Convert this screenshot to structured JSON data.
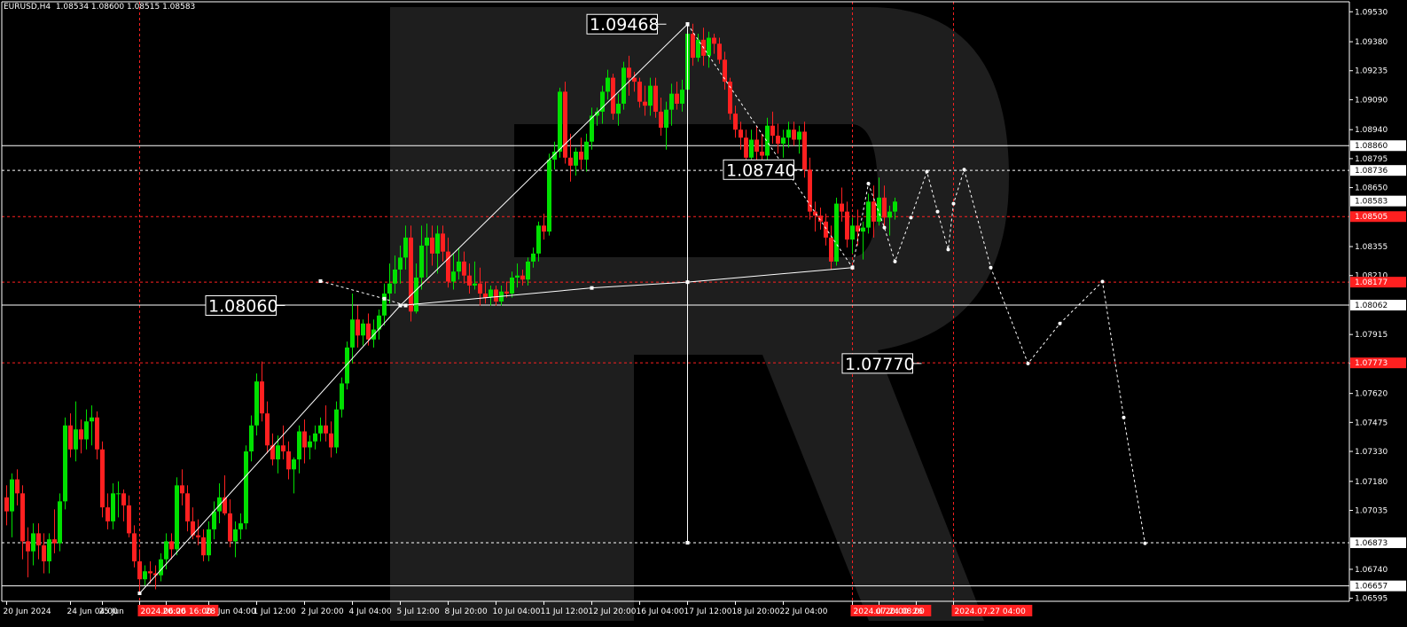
{
  "symbol_info": "EURUSD,H4  1.08534 1.08600 1.08515 1.08583",
  "colors": {
    "background": "#000000",
    "bull": "#00e000",
    "bear": "#ff2020",
    "grid": "#ff2020",
    "axis": "#ffffff",
    "watermark": "#222222"
  },
  "watermark_icon": "robo-r-logo",
  "chart_data": {
    "type": "candlestick",
    "title": "",
    "ylim": [
      1.0658,
      1.0958
    ],
    "price_ticks": [
      "1.09530",
      "1.09380",
      "1.09235",
      "1.09090",
      "1.08940",
      "1.08795",
      "1.08650",
      "1.08355",
      "1.08210",
      "1.07915",
      "1.07770",
      "1.07620",
      "1.07475",
      "1.07330",
      "1.07180",
      "1.07035",
      "1.06740",
      "1.06595"
    ],
    "highlighted_levels": [
      {
        "label": "1.08860",
        "style": "solid-white"
      },
      {
        "label": "1.08736",
        "style": "dashed-white"
      },
      {
        "label": "1.08583",
        "style": "current-price"
      },
      {
        "label": "1.08505",
        "style": "red-level"
      },
      {
        "label": "1.08177",
        "style": "red-level"
      },
      {
        "label": "1.08062",
        "style": "solid-white"
      },
      {
        "label": "1.07773",
        "style": "red-level"
      },
      {
        "label": "1.06873",
        "style": "dashed-white"
      },
      {
        "label": "1.06657",
        "style": "solid-white"
      }
    ],
    "time_ticks": [
      {
        "label": "20 Jun 2024",
        "i": 0
      },
      {
        "label": "24 Jun 04:00",
        "i": 12
      },
      {
        "label": "25 Jun",
        "i": 18
      },
      {
        "label": "2024.06.26 16:00",
        "i": 25,
        "highlight": true
      },
      {
        "label": "20:00",
        "i": 30
      },
      {
        "label": "28 Jun 04:00",
        "i": 38
      },
      {
        "label": "1 Jul 12:00",
        "i": 47
      },
      {
        "label": "2 Jul 20:00",
        "i": 56
      },
      {
        "label": "4 Jul 04:00",
        "i": 65
      },
      {
        "label": "5 Jul 12:00",
        "i": 74
      },
      {
        "label": "8 Jul 20:00",
        "i": 83
      },
      {
        "label": "10 Jul 04:00",
        "i": 92
      },
      {
        "label": "11 Jul 12:00",
        "i": 101
      },
      {
        "label": "12 Jul 20:00",
        "i": 110
      },
      {
        "label": "16 Jul 04:00",
        "i": 119
      },
      {
        "label": "17 Jul 12:00",
        "i": 128
      },
      {
        "label": "18 Jul 20:00",
        "i": 137
      },
      {
        "label": "22 Jul 04:00",
        "i": 146
      },
      {
        "label": "2024.07.24 08:00",
        "i": 159,
        "highlight": true
      },
      {
        "label": "ul 20:00",
        "i": 164
      },
      {
        "label": "26",
        "i": 171
      },
      {
        "label": "2024.07.27 04:00",
        "i": 178,
        "highlight": true
      }
    ],
    "candles": [
      [
        1.071,
        1.0716,
        1.0696,
        1.0703
      ],
      [
        1.0703,
        1.0722,
        1.069,
        1.0719
      ],
      [
        1.0719,
        1.0724,
        1.0706,
        1.0712
      ],
      [
        1.0712,
        1.0716,
        1.0679,
        1.0688
      ],
      [
        1.0688,
        1.0695,
        1.067,
        1.0683
      ],
      [
        1.0683,
        1.0697,
        1.0676,
        1.0692
      ],
      [
        1.0692,
        1.0697,
        1.0679,
        1.0686
      ],
      [
        1.0686,
        1.0692,
        1.0672,
        1.0678
      ],
      [
        1.0678,
        1.0692,
        1.0672,
        1.0689
      ],
      [
        1.0689,
        1.0704,
        1.0682,
        1.0687
      ],
      [
        1.0687,
        1.0712,
        1.0683,
        1.0708
      ],
      [
        1.0708,
        1.075,
        1.0704,
        1.0746
      ],
      [
        1.0746,
        1.0752,
        1.073,
        1.0734
      ],
      [
        1.0734,
        1.0758,
        1.0728,
        1.0744
      ],
      [
        1.0744,
        1.0749,
        1.0732,
        1.0739
      ],
      [
        1.0739,
        1.0754,
        1.0734,
        1.0748
      ],
      [
        1.0748,
        1.0756,
        1.0736,
        1.075
      ],
      [
        1.075,
        1.0753,
        1.0729,
        1.0734
      ],
      [
        1.0734,
        1.0738,
        1.07,
        1.0705
      ],
      [
        1.0705,
        1.0712,
        1.0694,
        1.0698
      ],
      [
        1.0698,
        1.0717,
        1.0694,
        1.0712
      ],
      [
        1.0712,
        1.0718,
        1.07,
        1.0712
      ],
      [
        1.0712,
        1.0714,
        1.0698,
        1.0706
      ],
      [
        1.0706,
        1.0711,
        1.069,
        1.0692
      ],
      [
        1.0692,
        1.0696,
        1.0675,
        1.0678
      ],
      [
        1.0678,
        1.0684,
        1.0662,
        1.0669
      ],
      [
        1.0669,
        1.0676,
        1.0666,
        1.0673
      ],
      [
        1.0673,
        1.0678,
        1.0667,
        1.0672
      ],
      [
        1.0672,
        1.0676,
        1.0664,
        1.0671
      ],
      [
        1.0671,
        1.0682,
        1.0668,
        1.0679
      ],
      [
        1.0679,
        1.0692,
        1.0674,
        1.0688
      ],
      [
        1.0688,
        1.0692,
        1.0679,
        1.0684
      ],
      [
        1.0684,
        1.072,
        1.0681,
        1.0716
      ],
      [
        1.0716,
        1.0724,
        1.0706,
        1.0712
      ],
      [
        1.0712,
        1.0716,
        1.0693,
        1.0698
      ],
      [
        1.0698,
        1.0705,
        1.0689,
        1.0691
      ],
      [
        1.0691,
        1.0699,
        1.0686,
        1.069
      ],
      [
        1.069,
        1.0694,
        1.0678,
        1.0681
      ],
      [
        1.0681,
        1.0698,
        1.0678,
        1.0694
      ],
      [
        1.0694,
        1.0708,
        1.0689,
        1.0703
      ],
      [
        1.0703,
        1.0717,
        1.0697,
        1.071
      ],
      [
        1.071,
        1.0721,
        1.0701,
        1.0702
      ],
      [
        1.0702,
        1.0709,
        1.0685,
        1.0688
      ],
      [
        1.0688,
        1.0698,
        1.068,
        1.0694
      ],
      [
        1.0694,
        1.0702,
        1.0689,
        1.0697
      ],
      [
        1.0697,
        1.0736,
        1.0694,
        1.0733
      ],
      [
        1.0733,
        1.0751,
        1.0728,
        1.0746
      ],
      [
        1.0746,
        1.0772,
        1.0741,
        1.0768
      ],
      [
        1.0768,
        1.0778,
        1.0748,
        1.0752
      ],
      [
        1.0752,
        1.0758,
        1.0732,
        1.0736
      ],
      [
        1.0736,
        1.0742,
        1.0726,
        1.0729
      ],
      [
        1.0729,
        1.0741,
        1.0722,
        1.0736
      ],
      [
        1.0736,
        1.0746,
        1.0729,
        1.0733
      ],
      [
        1.0733,
        1.0738,
        1.0719,
        1.0724
      ],
      [
        1.0724,
        1.073,
        1.0712,
        1.0729
      ],
      [
        1.0729,
        1.0746,
        1.0722,
        1.0743
      ],
      [
        1.0743,
        1.0749,
        1.0727,
        1.0735
      ],
      [
        1.0735,
        1.0741,
        1.0729,
        1.0738
      ],
      [
        1.0738,
        1.0746,
        1.0734,
        1.0742
      ],
      [
        1.0742,
        1.075,
        1.0738,
        1.0746
      ],
      [
        1.0746,
        1.0756,
        1.0738,
        1.0742
      ],
      [
        1.0742,
        1.0748,
        1.073,
        1.0735
      ],
      [
        1.0735,
        1.0758,
        1.0732,
        1.0754
      ],
      [
        1.0754,
        1.077,
        1.075,
        1.0767
      ],
      [
        1.0767,
        1.0788,
        1.0764,
        1.0785
      ],
      [
        1.0785,
        1.0812,
        1.0777,
        1.0799
      ],
      [
        1.0799,
        1.0806,
        1.0785,
        1.0791
      ],
      [
        1.0791,
        1.0799,
        1.0786,
        1.0797
      ],
      [
        1.0797,
        1.0802,
        1.0786,
        1.0789
      ],
      [
        1.0789,
        1.0799,
        1.0785,
        1.0794
      ],
      [
        1.0794,
        1.0804,
        1.0789,
        1.0801
      ],
      [
        1.0801,
        1.0817,
        1.0796,
        1.0812
      ],
      [
        1.0812,
        1.0827,
        1.0807,
        1.0817
      ],
      [
        1.0817,
        1.0831,
        1.0812,
        1.0824
      ],
      [
        1.0824,
        1.0836,
        1.0817,
        1.083
      ],
      [
        1.083,
        1.0846,
        1.0824,
        1.084
      ],
      [
        1.084,
        1.0846,
        1.0798,
        1.0803
      ],
      [
        1.0803,
        1.0827,
        1.0802,
        1.082
      ],
      [
        1.082,
        1.0846,
        1.0814,
        1.0836
      ],
      [
        1.0836,
        1.0847,
        1.082,
        1.084
      ],
      [
        1.084,
        1.0846,
        1.0826,
        1.0832
      ],
      [
        1.0832,
        1.0846,
        1.0822,
        1.0842
      ],
      [
        1.0842,
        1.0846,
        1.0828,
        1.0833
      ],
      [
        1.0833,
        1.084,
        1.0815,
        1.0818
      ],
      [
        1.0818,
        1.0832,
        1.0814,
        1.0823
      ],
      [
        1.0823,
        1.0835,
        1.0819,
        1.0828
      ],
      [
        1.0828,
        1.0833,
        1.0817,
        1.0821
      ],
      [
        1.0821,
        1.0827,
        1.0812,
        1.0816
      ],
      [
        1.0816,
        1.0828,
        1.0814,
        1.0817
      ],
      [
        1.0817,
        1.0825,
        1.0806,
        1.0812
      ],
      [
        1.0812,
        1.0818,
        1.0807,
        1.081
      ],
      [
        1.081,
        1.0816,
        1.0806,
        1.0814
      ],
      [
        1.0814,
        1.0816,
        1.0806,
        1.0808
      ],
      [
        1.0808,
        1.0816,
        1.0806,
        1.0813
      ],
      [
        1.0813,
        1.0818,
        1.081,
        1.0812
      ],
      [
        1.0812,
        1.0823,
        1.081,
        1.082
      ],
      [
        1.082,
        1.0827,
        1.0815,
        1.0821
      ],
      [
        1.0821,
        1.0824,
        1.0816,
        1.0819
      ],
      [
        1.0819,
        1.083,
        1.0816,
        1.0828
      ],
      [
        1.0828,
        1.0835,
        1.0825,
        1.0832
      ],
      [
        1.0832,
        1.0848,
        1.0828,
        1.0846
      ],
      [
        1.0846,
        1.0852,
        1.0839,
        1.0843
      ],
      [
        1.0843,
        1.0882,
        1.0841,
        1.0879
      ],
      [
        1.0879,
        1.0888,
        1.0874,
        1.0883
      ],
      [
        1.0883,
        1.0915,
        1.088,
        1.0913
      ],
      [
        1.0913,
        1.0918,
        1.0877,
        1.088
      ],
      [
        1.088,
        1.0892,
        1.0868,
        1.0876
      ],
      [
        1.0876,
        1.0885,
        1.0871,
        1.0883
      ],
      [
        1.0883,
        1.089,
        1.0874,
        1.0879
      ],
      [
        1.0879,
        1.0892,
        1.0873,
        1.0888
      ],
      [
        1.0888,
        1.0905,
        1.0884,
        1.0901
      ],
      [
        1.0901,
        1.0905,
        1.0896,
        1.0903
      ],
      [
        1.0903,
        1.0916,
        1.0897,
        1.0913
      ],
      [
        1.0913,
        1.0924,
        1.0909,
        1.092
      ],
      [
        1.092,
        1.0922,
        1.0899,
        1.0902
      ],
      [
        1.0902,
        1.0912,
        1.0896,
        1.0907
      ],
      [
        1.0907,
        1.0928,
        1.0904,
        1.0925
      ],
      [
        1.0925,
        1.0931,
        1.0911,
        1.092
      ],
      [
        1.092,
        1.0923,
        1.0913,
        1.0918
      ],
      [
        1.0918,
        1.092,
        1.0905,
        1.0908
      ],
      [
        1.0908,
        1.0916,
        1.0901,
        1.0906
      ],
      [
        1.0906,
        1.092,
        1.0901,
        1.0916
      ],
      [
        1.0916,
        1.092,
        1.09,
        1.0903
      ],
      [
        1.0903,
        1.091,
        1.0891,
        1.0895
      ],
      [
        1.0895,
        1.0908,
        1.0884,
        1.0904
      ],
      [
        1.0904,
        1.0917,
        1.0896,
        1.0912
      ],
      [
        1.0912,
        1.0918,
        1.0904,
        1.0907
      ],
      [
        1.0907,
        1.0919,
        1.0903,
        1.0914
      ],
      [
        1.0914,
        1.0946,
        1.091,
        1.0942
      ],
      [
        1.0942,
        1.0947,
        1.0926,
        1.093
      ],
      [
        1.093,
        1.0942,
        1.0928,
        1.0939
      ],
      [
        1.0939,
        1.0945,
        1.0926,
        1.0931
      ],
      [
        1.0931,
        1.0943,
        1.0925,
        1.094
      ],
      [
        1.094,
        1.0942,
        1.0932,
        1.0937
      ],
      [
        1.0937,
        1.094,
        1.0927,
        1.0929
      ],
      [
        1.0929,
        1.0933,
        1.0914,
        1.0918
      ],
      [
        1.0918,
        1.092,
        1.0899,
        1.0902
      ],
      [
        1.0902,
        1.0906,
        1.089,
        1.0894
      ],
      [
        1.0894,
        1.0898,
        1.0884,
        1.089
      ],
      [
        1.089,
        1.0894,
        1.0877,
        1.088
      ],
      [
        1.088,
        1.0894,
        1.0874,
        1.0889
      ],
      [
        1.0889,
        1.0896,
        1.0879,
        1.0883
      ],
      [
        1.0883,
        1.0892,
        1.0876,
        1.0881
      ],
      [
        1.0881,
        1.09,
        1.0877,
        1.0896
      ],
      [
        1.0896,
        1.0903,
        1.0887,
        1.0891
      ],
      [
        1.0891,
        1.0897,
        1.0882,
        1.0887
      ],
      [
        1.0887,
        1.0894,
        1.088,
        1.089
      ],
      [
        1.089,
        1.0898,
        1.0885,
        1.0894
      ],
      [
        1.0894,
        1.0898,
        1.0886,
        1.0889
      ],
      [
        1.0889,
        1.0896,
        1.0882,
        1.0893
      ],
      [
        1.0893,
        1.0898,
        1.087,
        1.0874
      ],
      [
        1.0874,
        1.088,
        1.0849,
        1.0853
      ],
      [
        1.0853,
        1.0858,
        1.0843,
        1.0851
      ],
      [
        1.0851,
        1.0855,
        1.0844,
        1.0848
      ],
      [
        1.0848,
        1.0852,
        1.0836,
        1.084
      ],
      [
        1.084,
        1.0846,
        1.0824,
        1.0828
      ],
      [
        1.0828,
        1.086,
        1.0826,
        1.0857
      ],
      [
        1.0857,
        1.0865,
        1.0848,
        1.0853
      ],
      [
        1.0853,
        1.0858,
        1.0835,
        1.0839
      ],
      [
        1.0839,
        1.085,
        1.0832,
        1.0846
      ],
      [
        1.0846,
        1.0854,
        1.0836,
        1.0843
      ],
      [
        1.0843,
        1.0848,
        1.0829,
        1.0845
      ],
      [
        1.0845,
        1.0862,
        1.0842,
        1.0858
      ],
      [
        1.0858,
        1.0866,
        1.084,
        1.0848
      ],
      [
        1.0848,
        1.087,
        1.0846,
        1.086
      ],
      [
        1.086,
        1.0866,
        1.0844,
        1.085
      ],
      [
        1.085,
        1.0856,
        1.0841,
        1.0853
      ],
      [
        1.0853,
        1.086,
        1.0849,
        1.0858
      ]
    ],
    "time_marker_index": 127,
    "markers": [
      {
        "label": "1.09468",
        "i": 128,
        "p": 1.09468,
        "xoff": -34
      },
      {
        "label": "1.08060",
        "i": 54,
        "p": 1.0806,
        "xoff": -20
      },
      {
        "label": "1.08740",
        "i": 156,
        "p": 1.0874,
        "xoff": -48
      },
      {
        "label": "1.07770",
        "i": 174,
        "p": 1.0777,
        "xoff": -22
      }
    ],
    "structure_lines": [
      {
        "style": "solid",
        "points": [
          [
            25,
            1.0662
          ],
          [
            74,
            1.0806
          ],
          [
            128,
            1.09468
          ]
        ]
      },
      {
        "style": "solid",
        "points": [
          [
            74,
            1.0806
          ],
          [
            110,
            1.08148
          ],
          [
            128,
            1.08177
          ],
          [
            159,
            1.0825
          ]
        ]
      },
      {
        "style": "dashed",
        "points": [
          [
            59,
            1.08182
          ],
          [
            71,
            1.08094
          ],
          [
            75,
            1.0806
          ]
        ]
      },
      {
        "style": "dashed",
        "points": [
          [
            128,
            1.09468
          ],
          [
            159,
            1.0825
          ]
        ]
      },
      {
        "style": "solid",
        "points": [
          [
            128,
            1.09468
          ],
          [
            128,
            1.06873
          ]
        ]
      }
    ],
    "forecast_path": [
      [
        159,
        1.0825
      ],
      [
        162,
        1.0867
      ],
      [
        165,
        1.0845
      ],
      [
        167,
        1.0828
      ],
      [
        170,
        1.085
      ],
      [
        173,
        1.0873
      ],
      [
        175,
        1.0853
      ],
      [
        177,
        1.0834
      ],
      [
        178,
        1.0857
      ],
      [
        180,
        1.0874
      ],
      [
        185,
        1.0825
      ],
      [
        192,
        1.0777
      ],
      [
        198,
        1.0797
      ],
      [
        206,
        1.0818
      ],
      [
        210,
        1.075
      ],
      [
        214,
        1.0687
      ]
    ]
  }
}
